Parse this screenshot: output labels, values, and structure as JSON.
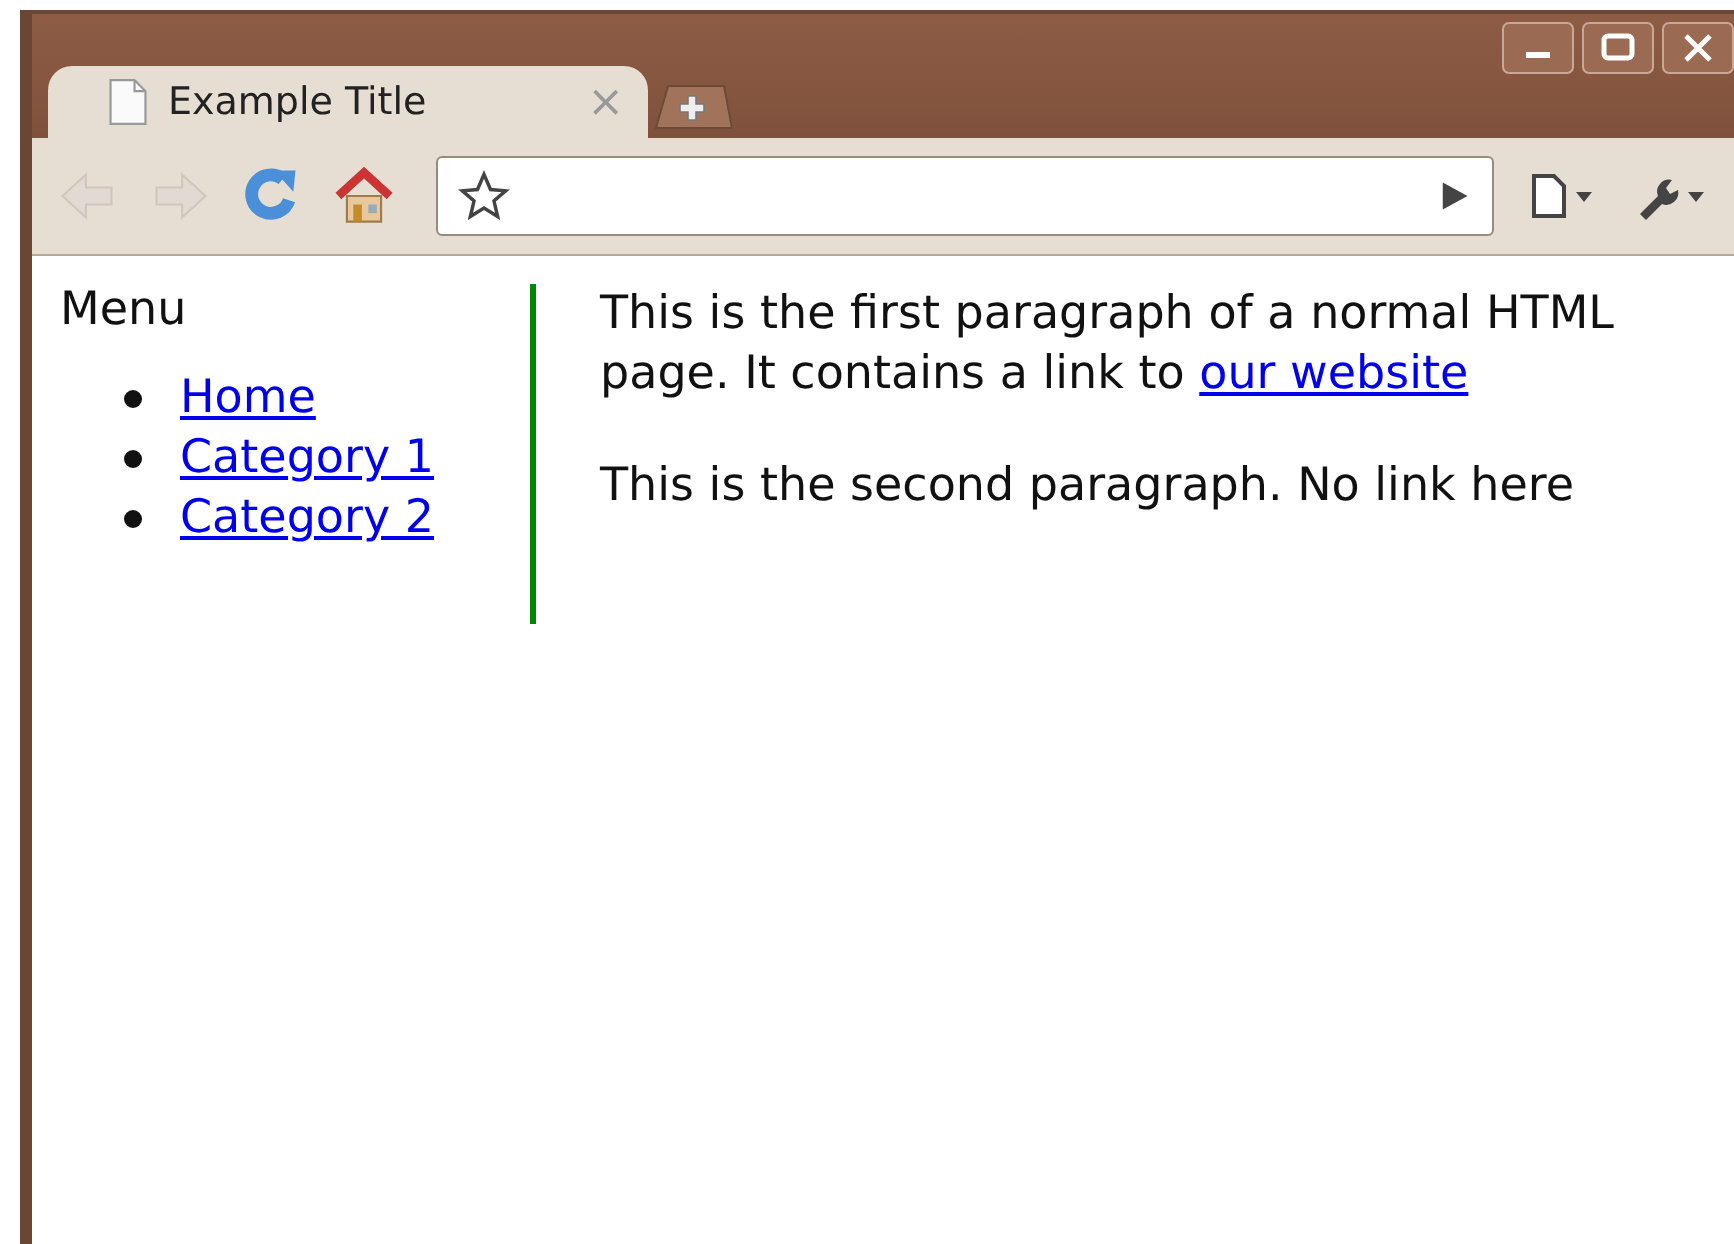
{
  "tab": {
    "title": "Example Title",
    "selected": true,
    "close": "×"
  },
  "sidebar": {
    "heading": "Menu",
    "links": [
      {
        "label": "Home"
      },
      {
        "label": "Category 1"
      },
      {
        "label": "Category 2"
      }
    ]
  },
  "paragraphs": [
    {
      "text": "This is the first paragraph of a normal HTML page. It contains a link to ",
      "link": "our website"
    },
    {
      "text": "This is the second paragraph. No link here"
    }
  ]
}
